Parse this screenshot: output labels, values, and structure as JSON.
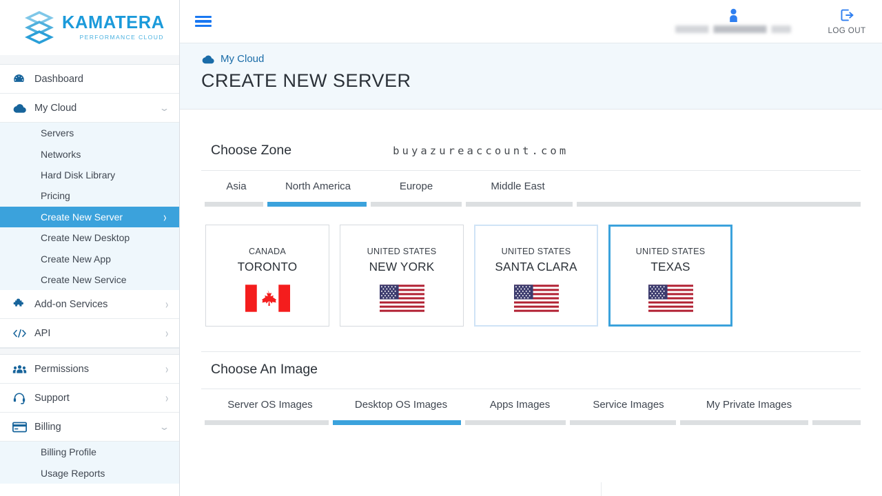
{
  "brand": {
    "name": "KAMATERA",
    "tagline": "PERFORMANCE CLOUD",
    "logo_icon": "kamatera-stack-logo",
    "accent_color": "#1b9ada"
  },
  "sidebar": {
    "items": [
      {
        "label": "Dashboard",
        "icon": "dashboard-gauge-icon",
        "caret": ""
      },
      {
        "label": "My Cloud",
        "icon": "cloud-icon",
        "caret": "chevron-down-icon"
      }
    ],
    "my_cloud_children": [
      {
        "label": "Servers",
        "active": false,
        "caret": ""
      },
      {
        "label": "Networks",
        "active": false,
        "caret": ""
      },
      {
        "label": "Hard Disk Library",
        "active": false,
        "caret": ""
      },
      {
        "label": "Pricing",
        "active": false,
        "caret": ""
      },
      {
        "label": "Create New Server",
        "active": true,
        "caret": "chevron-right-icon"
      },
      {
        "label": "Create New Desktop",
        "active": false,
        "caret": ""
      },
      {
        "label": "Create New App",
        "active": false,
        "caret": ""
      },
      {
        "label": "Create New Service",
        "active": false,
        "caret": ""
      }
    ],
    "items_group2": [
      {
        "label": "Add-on Services",
        "icon": "puzzle-piece-icon",
        "caret": "chevron-right-icon"
      },
      {
        "label": "API",
        "icon": "code-brackets-icon",
        "caret": "chevron-right-icon"
      }
    ],
    "items_group3": [
      {
        "label": "Permissions",
        "icon": "people-group-icon",
        "caret": "chevron-right-icon"
      },
      {
        "label": "Support",
        "icon": "headset-icon",
        "caret": "chevron-right-icon"
      },
      {
        "label": "Billing",
        "icon": "credit-card-icon",
        "caret": "chevron-down-icon"
      }
    ],
    "billing_children": [
      {
        "label": "Billing Profile",
        "active": false
      },
      {
        "label": "Usage Reports",
        "active": false
      }
    ],
    "active_color": "#3ba2dc",
    "submenu_bg": "#eff7fc"
  },
  "topbar": {
    "menu_icon": "hamburger-menu-icon",
    "user_icon": "user-avatar-icon",
    "user_email": "",
    "logout_icon": "logout-arrow-icon",
    "logout_label": "LOG OUT"
  },
  "page": {
    "breadcrumb_icon": "cloud-icon",
    "breadcrumb": "My Cloud",
    "title": "CREATE NEW SERVER"
  },
  "zone_section": {
    "title": "Choose Zone",
    "watermark": "buyazureaccount.com",
    "tabs": [
      {
        "label": "Asia",
        "active": false
      },
      {
        "label": "North America",
        "active": true
      },
      {
        "label": "Europe",
        "active": false
      },
      {
        "label": "Middle East",
        "active": false
      }
    ],
    "cards": [
      {
        "country": "CANADA",
        "city": "TORONTO",
        "flag": "canada-flag",
        "state": "default"
      },
      {
        "country": "UNITED STATES",
        "city": "NEW YORK",
        "flag": "usa-flag",
        "state": "default"
      },
      {
        "country": "UNITED STATES",
        "city": "SANTA CLARA",
        "flag": "usa-flag",
        "state": "hover"
      },
      {
        "country": "UNITED STATES",
        "city": "TEXAS",
        "flag": "usa-flag",
        "state": "selected"
      }
    ]
  },
  "image_section": {
    "title": "Choose An Image",
    "tabs": [
      {
        "label": "Server OS Images",
        "active": false
      },
      {
        "label": "Desktop OS Images",
        "active": true
      },
      {
        "label": "Apps Images",
        "active": false
      },
      {
        "label": "Service Images",
        "active": false
      },
      {
        "label": "My Private Images",
        "active": false
      }
    ]
  }
}
